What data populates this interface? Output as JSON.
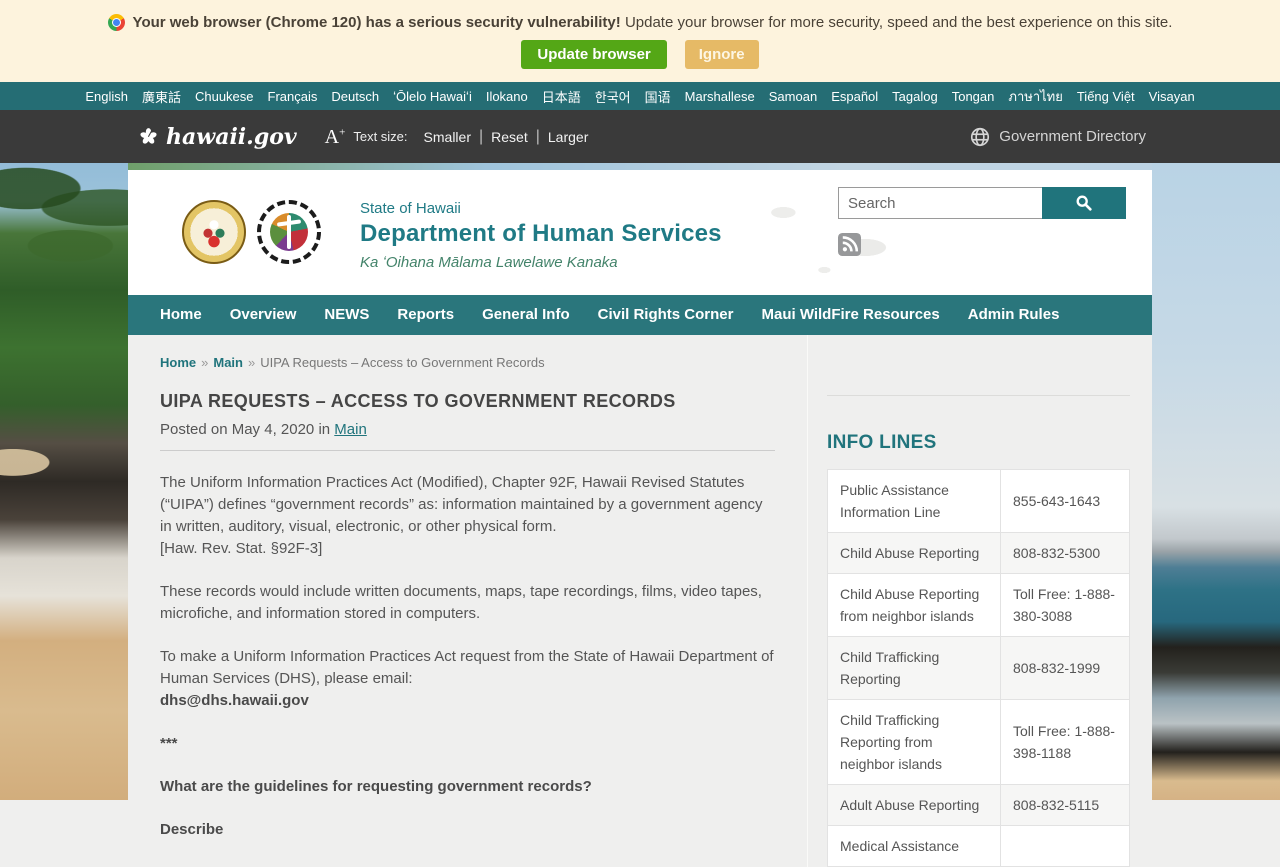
{
  "banner": {
    "message_bold": "Your web browser (Chrome 120) has a serious security vulnerability!",
    "message_rest": "Update your browser for more security, speed and the best experience on this site.",
    "update_label": "Update browser",
    "ignore_label": "Ignore"
  },
  "language_bar": {
    "items": [
      "English",
      "廣東話",
      "Chuukese",
      "Français",
      "Deutsch",
      "ʻŌlelo Hawaiʻi",
      "Ilokano",
      "日本語",
      "한국어",
      "国语",
      "Marshallese",
      "Samoan",
      "Español",
      "Tagalog",
      "Tongan",
      "ภาษาไทย",
      "Tiếng Việt",
      "Visayan"
    ]
  },
  "utility_bar": {
    "logo_text": "hawaii.gov",
    "text_size_label": "Text size:",
    "smaller": "Smaller",
    "reset": "Reset",
    "larger": "Larger",
    "separator": "|",
    "directory_label": "Government Directory"
  },
  "site_header": {
    "state": "State of Hawaii",
    "department": "Department of Human Services",
    "hawaiian_name": "Ka ʻOihana Mālama Lawelawe Kanaka",
    "search_placeholder": "Search"
  },
  "nav": {
    "items": [
      "Home",
      "Overview",
      "NEWS",
      "Reports",
      "General Info",
      "Civil Rights Corner",
      "Maui WildFire Resources",
      "Admin Rules"
    ]
  },
  "breadcrumb": {
    "home": "Home",
    "section": "Main",
    "current": "UIPA Requests – Access to Government Records",
    "separator": "»"
  },
  "article": {
    "title": "UIPA REQUESTS – ACCESS TO GOVERNMENT RECORDS",
    "meta_prefix": "Posted on May 4, 2020 in ",
    "meta_link": "Main",
    "p1a": "The Uniform Information Practices Act (Modified), Chapter 92F, Hawaii Revised Statutes (“UIPA”) defines “government records” as: information maintained by a government agency in written, auditory, visual, electronic, or other physical form.",
    "p1b": "[Haw. Rev. Stat. §92F-3]",
    "p2": "These records would include written documents, maps, tape recordings, films, video tapes, microfiche, and information stored in computers.",
    "p3a": "To make a Uniform Information Practices Act request from the State of Hawaii Department of Human Services (DHS), please email:",
    "p3b": "dhs@dhs.hawaii.gov",
    "stars": "***",
    "question": "What are the guidelines for requesting government records?",
    "describe": "Describe"
  },
  "sidebar": {
    "heading": "INFO LINES",
    "rows": [
      {
        "label": "Public Assistance Information Line",
        "number": "855-643-1643"
      },
      {
        "label": "Child Abuse Reporting",
        "number": "808-832-5300"
      },
      {
        "label": "Child Abuse Reporting from neighbor islands",
        "number": "Toll Free: 1-888-380-3088"
      },
      {
        "label": "Child Trafficking Reporting",
        "number": "808-832-1999"
      },
      {
        "label": "Child Trafficking Reporting from neighbor islands",
        "number": "Toll Free: 1-888-398-1188"
      },
      {
        "label": "Adult Abuse Reporting",
        "number": "808-832-5115"
      },
      {
        "label": "Medical Assistance",
        "number": ""
      }
    ]
  },
  "colors": {
    "accent_teal": "#20747c",
    "nav_teal": "#2a767c",
    "banner_bg": "#fdf3dd",
    "update_green": "#54a716",
    "ignore_tan": "#e6ba66"
  }
}
